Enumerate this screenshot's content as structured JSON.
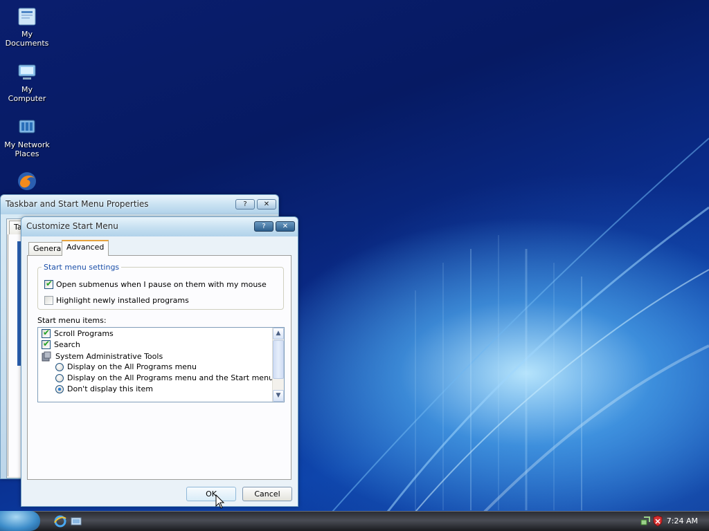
{
  "desktop": {
    "icons": [
      {
        "label_line1": "My",
        "label_line2": "Documents",
        "icon": "folder-documents-icon"
      },
      {
        "label_line1": "My",
        "label_line2": "Computer",
        "icon": "computer-icon"
      },
      {
        "label_line1": "My Network",
        "label_line2": "Places",
        "icon": "network-places-icon"
      },
      {
        "label_line1": "",
        "label_line2": "",
        "icon": "firefox-icon"
      }
    ]
  },
  "back_window": {
    "title": "Taskbar and Start Menu Properties",
    "help_btn": "?",
    "close_btn": "✕",
    "tab_partial": "Ta"
  },
  "dialog": {
    "title": "Customize Start Menu",
    "help_btn": "?",
    "close_btn": "✕",
    "tabs": [
      "General",
      "Advanced"
    ],
    "active_tab": "Advanced",
    "settings_group": {
      "legend": "Start menu settings",
      "options": [
        {
          "label": "Open submenus when I pause on them with my mouse",
          "checked": true
        },
        {
          "label": "Highlight newly installed programs",
          "checked": false
        }
      ]
    },
    "items_label": "Start menu items:",
    "items": [
      {
        "type": "checkbox",
        "label": "Scroll Programs",
        "checked": true
      },
      {
        "type": "checkbox",
        "label": "Search",
        "checked": true
      },
      {
        "type": "header",
        "label": "System Administrative Tools"
      },
      {
        "type": "radio",
        "label": "Display on the All Programs menu",
        "selected": false
      },
      {
        "type": "radio",
        "label": "Display on the All Programs menu and the Start menu",
        "selected": false
      },
      {
        "type": "radio",
        "label": "Don't display this item",
        "selected": true
      }
    ],
    "ok_label": "OK",
    "cancel_label": "Cancel"
  },
  "taskbar": {
    "time": "7:24 AM"
  },
  "colors": {
    "accent": "#e6a23c",
    "legend_text": "#1b4fa8",
    "check_green": "#21a121"
  }
}
